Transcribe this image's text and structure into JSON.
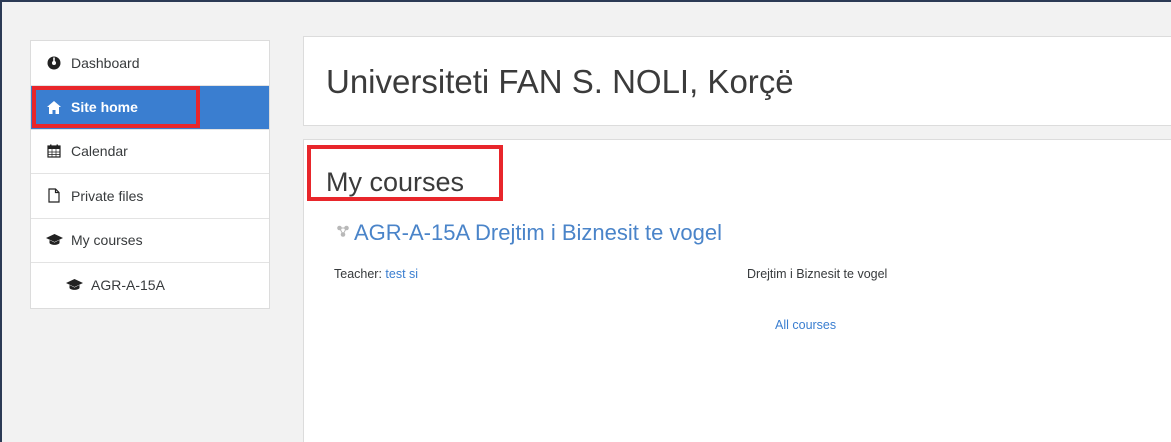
{
  "sidebar": {
    "items": [
      {
        "label": "Dashboard",
        "icon": "dashboard-icon"
      },
      {
        "label": "Site home",
        "icon": "home-icon"
      },
      {
        "label": "Calendar",
        "icon": "calendar-icon"
      },
      {
        "label": "Private files",
        "icon": "file-icon"
      },
      {
        "label": "My courses",
        "icon": "graduation-cap-icon"
      },
      {
        "label": "AGR-A-15A",
        "icon": "graduation-cap-icon"
      }
    ]
  },
  "header": {
    "title": "Universiteti FAN S. NOLI, Korçë"
  },
  "main": {
    "heading": "My courses",
    "course": {
      "name": "AGR-A-15A Drejtim i Biznesit te vogel",
      "icon": "course-icon",
      "teacher_label": "Teacher:",
      "teacher_name": "test si",
      "summary": "Drejtim i Biznesit te vogel"
    },
    "all_courses_label": "All courses"
  },
  "colors": {
    "accent": "#3a7ed0",
    "highlight": "#e8262b",
    "link": "#4a84c9"
  }
}
